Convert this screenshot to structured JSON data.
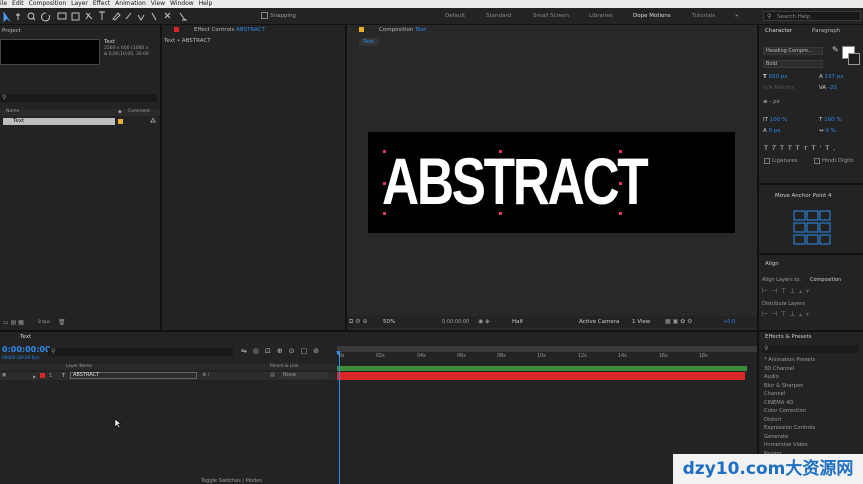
{
  "menu": [
    "ile",
    "Edit",
    "Composition",
    "Layer",
    "Effect",
    "Animation",
    "View",
    "Window",
    "Help"
  ],
  "toolbar": {
    "snapping": "Snapping",
    "search_placeholder": "Search Help"
  },
  "workspaces": [
    "Default",
    "Standard",
    "Small Screen",
    "Libraries",
    "Dope Motions",
    "Tutorials"
  ],
  "project": {
    "title": "Project",
    "item_name": "Text",
    "item_info1": "2560 x 600 (1080 x",
    "item_info2": "Δ 0;00;10;00, 30.00",
    "col_name": "Name",
    "col_comment": "Comment",
    "row_name": "Text",
    "bpc": "8 bpc"
  },
  "effect_controls": {
    "title": "Effect Controls",
    "layer": "ABSTRACT",
    "subtitle": "Text • ABSTRACT"
  },
  "composition": {
    "title": "Composition",
    "name": "Text",
    "tab": "Text",
    "text": "ABSTRACT",
    "zoom": "50%",
    "timecode": "0:00:00:00",
    "resolution": "Half",
    "camera": "Active Camera",
    "view": "1 View",
    "exposure": "+0.0"
  },
  "character": {
    "tab_char": "Character",
    "tab_para": "Paragraph",
    "font": "Heading Compre...",
    "style": "Bold",
    "size": "500 px",
    "leading": "137 px",
    "kerning": "Metrics",
    "tracking": "-20",
    "stroke": "- px",
    "vscale": "100 %",
    "hscale": "100 %",
    "baseline": "0 px",
    "tsume": "0 %",
    "ligatures": "Ligatures",
    "hindi": "Hindi Digits"
  },
  "anchor": {
    "title": "Move Anchor Point 4"
  },
  "align": {
    "title": "Align",
    "align_to": "Align Layers to:",
    "target": "Composition",
    "distribute": "Distribute Layers"
  },
  "timeline": {
    "tab": "Text",
    "time": "0:00:00:00",
    "frames": "00000 (30.00 fps)",
    "col_layer": "Layer Name",
    "col_parent": "Parent & Link",
    "layer_num": "1",
    "layer_name": "ABSTRACT",
    "parent": "None",
    "ticks": [
      "0s",
      "02s",
      "04s",
      "06s",
      "08s",
      "10s",
      "12s",
      "14s",
      "16s",
      "18s"
    ],
    "toggle": "Toggle Switches / Modes"
  },
  "effects": {
    "title": "Effects & Presets",
    "items": [
      "* Animation Presets",
      "3D Channel",
      "Audio",
      "Blur & Sharpen",
      "Channel",
      "CINEMA 4D",
      "Color Correction",
      "Distort",
      "Expression Controls",
      "Generate",
      "Immersive Video",
      "Keying"
    ]
  },
  "watermark": "dzy10.com大资源网",
  "colors": {
    "accent": "#2d8ceb",
    "handle": "#e0365b",
    "bar_red": "#d92727",
    "bar_green": "#3c8a3c"
  }
}
